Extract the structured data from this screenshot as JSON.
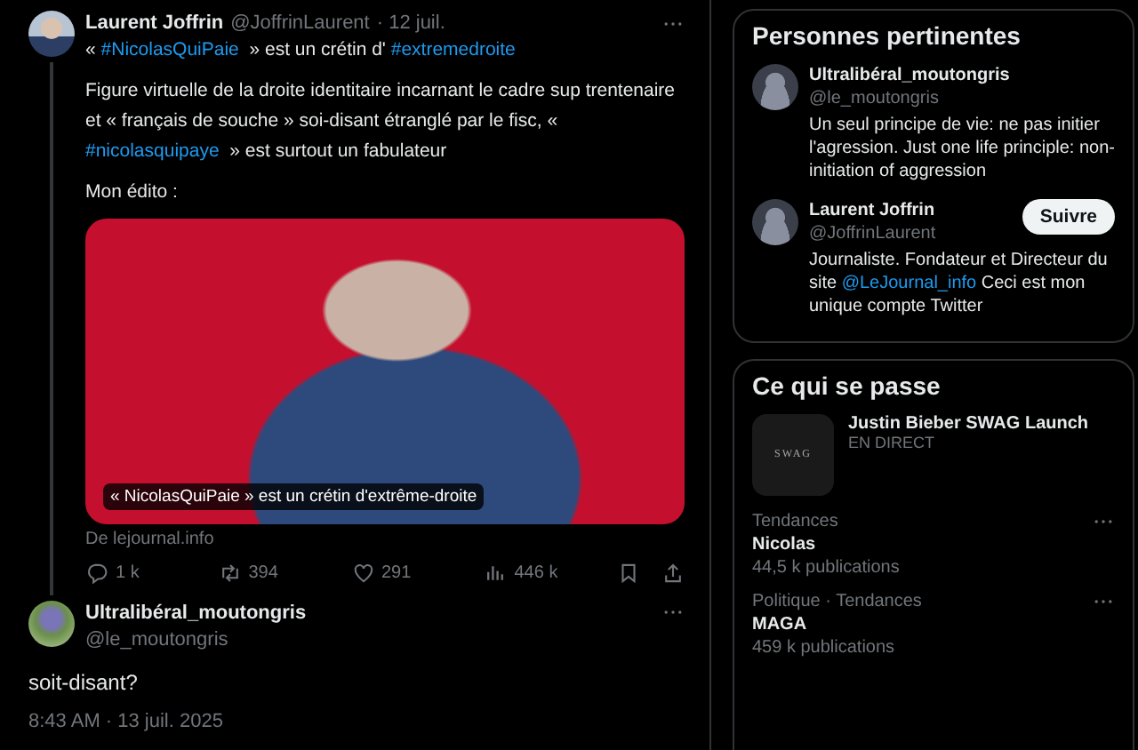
{
  "tweet": {
    "author": {
      "name": "Laurent Joffrin",
      "handle": "@JoffrinLaurent",
      "date": "· 12 juil."
    },
    "paragraphs": [
      [
        {
          "kind": "plain",
          "text": "« "
        },
        {
          "kind": "link",
          "text": "#NicolasQuiPaie"
        },
        {
          "kind": "plain",
          "text": "  » est un crétin d' "
        },
        {
          "kind": "link",
          "text": "#extremedroite"
        }
      ],
      [
        {
          "kind": "plain",
          "text": "Figure virtuelle de la droite identitaire incarnant le cadre sup trentenaire et « français de souche » soi-disant étranglé par le fisc, « "
        },
        {
          "kind": "link",
          "text": "#nicolasquipaye"
        },
        {
          "kind": "plain",
          "text": "  » est surtout un fabulateur"
        }
      ],
      [
        {
          "kind": "plain",
          "text": "Mon édito :"
        }
      ]
    ],
    "card": {
      "caption": "« NicolasQuiPaie » est un crétin d'extrême-droite",
      "source": "De lejournal.info"
    },
    "actions": [
      {
        "kind": "reply",
        "count": "1 k"
      },
      {
        "kind": "repost",
        "count": "394"
      },
      {
        "kind": "like",
        "count": "291"
      },
      {
        "kind": "views",
        "count": "446 k"
      }
    ]
  },
  "reply": {
    "name": "Ultralibéral_moutongris",
    "handle": "@le_moutongris",
    "text": "soit-disant?",
    "timestamp": "8:43 AM · 13 juil. 2025"
  },
  "related_people": {
    "title": "Personnes pertinentes",
    "people": [
      {
        "name": "Ultralibéral_moutongris",
        "handle": "@le_moutongris",
        "bio": [
          {
            "kind": "plain",
            "text": "Un seul principe de vie: ne pas initier l'agression. Just one life principle: non-initiation of aggression"
          }
        ]
      },
      {
        "name": "Laurent Joffrin",
        "handle": "@JoffrinLaurent",
        "follow_button": "Suivre",
        "bio": [
          {
            "kind": "plain",
            "text": "Journaliste. Fondateur et Directeur du site "
          },
          {
            "kind": "link",
            "text": "@LeJournal_info"
          },
          {
            "kind": "plain",
            "text": " Ceci est mon unique compte Twitter"
          }
        ]
      }
    ]
  },
  "whats_happening": {
    "title": "Ce qui se passe",
    "event": {
      "thumb_text": "SWAG",
      "title": "Justin Bieber SWAG Launch",
      "status": "EN DIRECT"
    },
    "trends": [
      {
        "context": "Tendances",
        "name": "Nicolas",
        "count": "44,5 k publications"
      },
      {
        "context": "Politique · Tendances",
        "name": "MAGA",
        "count": "459 k publications"
      }
    ]
  }
}
